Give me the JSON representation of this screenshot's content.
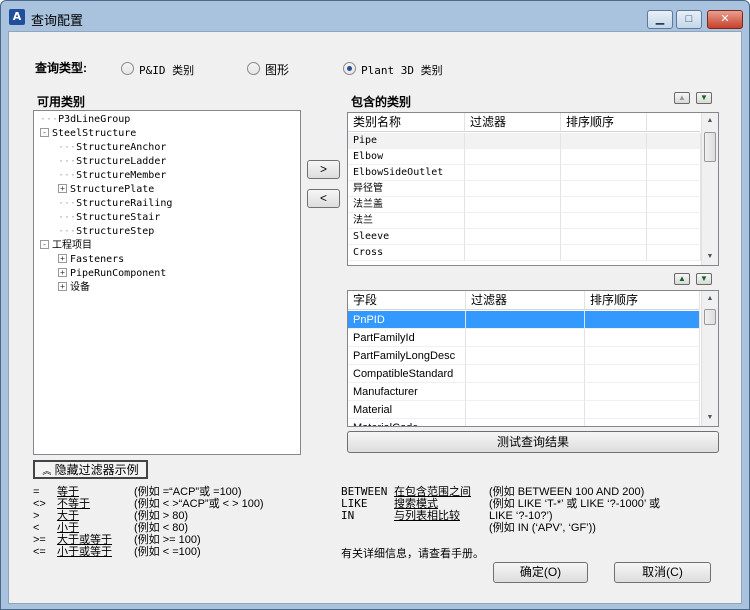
{
  "window": {
    "title": "查询配置",
    "icon_glyph": "A"
  },
  "query_type": {
    "label": "查询类型:",
    "options": [
      {
        "label": "P&ID 类别",
        "checked": false
      },
      {
        "label": "图形",
        "checked": false
      },
      {
        "label": "Plant 3D 类别",
        "checked": true
      }
    ]
  },
  "available": {
    "label": "可用类别",
    "tree": [
      {
        "label": "P3dLineGroup",
        "level": 0,
        "expander": ""
      },
      {
        "label": "SteelStructure",
        "level": 0,
        "expander": "-"
      },
      {
        "label": "StructureAnchor",
        "level": 1,
        "expander": ""
      },
      {
        "label": "StructureLadder",
        "level": 1,
        "expander": ""
      },
      {
        "label": "StructureMember",
        "level": 1,
        "expander": ""
      },
      {
        "label": "StructurePlate",
        "level": 1,
        "expander": "+"
      },
      {
        "label": "StructureRailing",
        "level": 1,
        "expander": ""
      },
      {
        "label": "StructureStair",
        "level": 1,
        "expander": ""
      },
      {
        "label": "StructureStep",
        "level": 1,
        "expander": ""
      },
      {
        "label": "工程项目",
        "level": 0,
        "expander": "-"
      },
      {
        "label": "Fasteners",
        "level": 1,
        "expander": "+"
      },
      {
        "label": "PipeRunComponent",
        "level": 1,
        "expander": "+"
      },
      {
        "label": "设备",
        "level": 1,
        "expander": "+"
      }
    ]
  },
  "move_buttons": {
    "add": ">",
    "remove": "<"
  },
  "included": {
    "label": "包含的类别",
    "columns": [
      "类别名称",
      "过滤器",
      "排序顺序"
    ],
    "rows": [
      "Pipe",
      "Elbow",
      "ElbowSideOutlet",
      "异径管",
      "法兰盖",
      "法兰",
      "Sleeve",
      "Cross"
    ]
  },
  "fields": {
    "columns": [
      "字段",
      "过滤器",
      "排序顺序"
    ],
    "rows": [
      "PnPID",
      "PartFamilyId",
      "PartFamilyLongDesc",
      "CompatibleStandard",
      "Manufacturer",
      "Material",
      "MaterialCode"
    ],
    "selected_index": 0
  },
  "test_button": "测试查询结果",
  "filter_toggle": {
    "label": "隐藏过滤器示例",
    "icon": "chevron-up-double"
  },
  "legend_left": [
    {
      "op": "=",
      "name": "等于",
      "example": "(例如 =“ACP”或 =100)"
    },
    {
      "op": "<>",
      "name": "不等于",
      "example": "(例如 < >“ACP”或 < > 100)"
    },
    {
      "op": ">",
      "name": "大于",
      "example": "(例如 > 80)"
    },
    {
      "op": "<",
      "name": "小于",
      "example": "(例如 < 80)"
    },
    {
      "op": ">=",
      "name": "大于或等于",
      "example": "(例如 >= 100)"
    },
    {
      "op": "<=",
      "name": "小于或等于",
      "example": "(例如 < =100)"
    }
  ],
  "legend_right": [
    {
      "op": "BETWEEN",
      "name": "在包含范围之间",
      "example": "(例如 BETWEEN 100 AND 200)"
    },
    {
      "op": "LIKE",
      "name": "搜索模式",
      "example": "(例如 LIKE ‘T-*’ 或 LIKE ‘?-1000’ 或"
    },
    {
      "op": "IN",
      "name": "与列表相比较",
      "example": "LIKE ‘?-10?’)"
    },
    {
      "op": "",
      "name": "",
      "example": "(例如 IN (‘APV’, ‘GF’))"
    }
  ],
  "help_text": "有关详细信息，请查看手册。",
  "ok_button": "确定(O)",
  "cancel_button": "取消(C)"
}
